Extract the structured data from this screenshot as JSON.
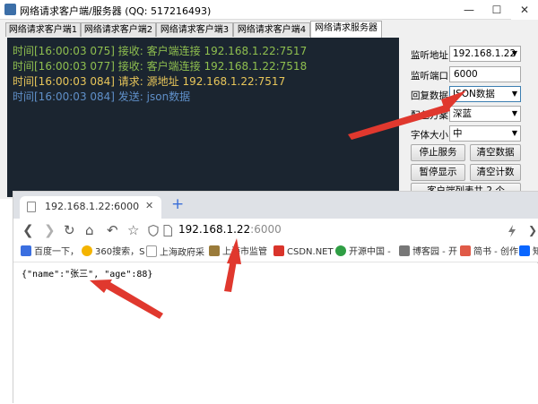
{
  "qt": {
    "title": "网络请求客户端/服务器 (QQ: 517216493)",
    "window_controls": {
      "minimize": "—",
      "maximize": "☐",
      "close": "✕"
    },
    "tabs": [
      {
        "label": "网络请求客户端1"
      },
      {
        "label": "网络请求客户端2"
      },
      {
        "label": "网络请求客户端3"
      },
      {
        "label": "网络请求客户端4"
      },
      {
        "label": "网络请求服务器",
        "active": true
      }
    ],
    "log": [
      {
        "text": "时间[16:00:03 075] 接收: 客户端连接 192.168.1.22:7517",
        "color": "#8fbf4f"
      },
      {
        "text": "时间[16:00:03 077] 接收: 客户端连接 192.168.1.22:7518",
        "color": "#8fbf4f"
      },
      {
        "text": "时间[16:00:03 084] 请求: 源地址 192.168.1.22:7517",
        "color": "#e8c65a"
      },
      {
        "text": "时间[16:00:03 084] 发送: json数据",
        "color": "#5f8fc8"
      }
    ],
    "controls": {
      "listen_addr_label": "监听地址",
      "listen_addr_value": "192.168.1.22",
      "listen_port_label": "监听端口",
      "listen_port_value": "6000",
      "reply_label": "回复数据",
      "reply_value": "JSON数据",
      "color_label": "配色方案",
      "color_value": "深蓝",
      "font_label": "字体大小",
      "font_value": "中",
      "stop_service": "停止服务",
      "clear_data": "清空数据",
      "pause_display": "暂停显示",
      "clear_count": "清空计数",
      "client_list": "客户端列表共 2 个"
    }
  },
  "browser": {
    "tab_title": "192.168.1.22:6000",
    "tab_close": "✕",
    "new_tab": "+",
    "nav": {
      "back": "❮",
      "forward": "❯",
      "reload": "↻",
      "home": "⌂",
      "undo": "↶",
      "star": "☆"
    },
    "url_host": "192.168.1.22",
    "url_port": ":6000",
    "bookmarks": [
      {
        "label": "百度一下，",
        "color": "#3b6fe0"
      },
      {
        "label": "360搜索，S",
        "color": "#f4b400"
      },
      {
        "label": "上海政府采",
        "color": "#bbbbbb"
      },
      {
        "label": "上海市监管",
        "color": "#9a7b3a"
      },
      {
        "label": "CSDN.NET",
        "color": "#d9342b"
      },
      {
        "label": "开源中国 -",
        "color": "#2f9e44"
      },
      {
        "label": "博客园 - 开",
        "color": "#777777"
      },
      {
        "label": "简书 - 创作",
        "color": "#e05a47"
      },
      {
        "label": "知",
        "color": "#0a66ff"
      }
    ],
    "body": "{\"name\":\"张三\", \"age\":88}"
  },
  "colors": {
    "annotation_arrow": "#e0382e",
    "log_background": "#1b2530"
  }
}
